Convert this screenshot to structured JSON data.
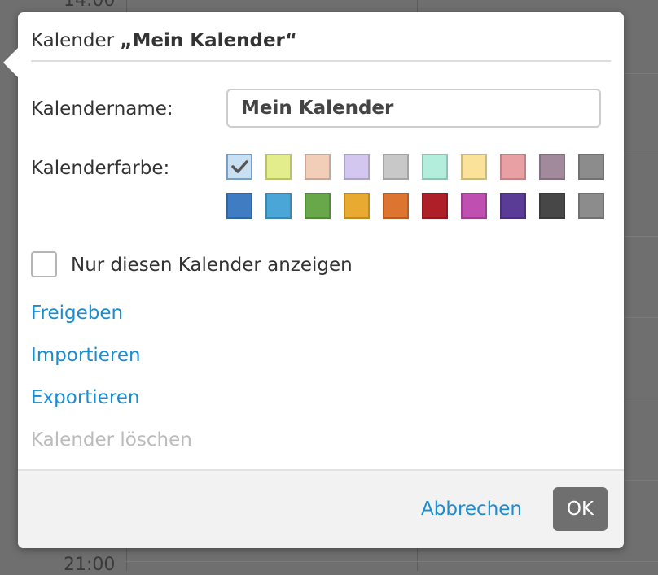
{
  "background": {
    "time_top": "14:00",
    "time_bottom": "21:00"
  },
  "dialog": {
    "title_prefix": "Kalender ",
    "title_name": "„Mein Kalender“",
    "name_label": "Kalendername:",
    "name_value": "Mein Kalender",
    "color_label": "Kalenderfarbe:",
    "colors": [
      "#c9dff2",
      "#e3ed8c",
      "#f2cdb8",
      "#d3c7f0",
      "#c8c8c8",
      "#b3eddb",
      "#fbe29a",
      "#e8a0a4",
      "#a08a9c",
      "#8c8c8c",
      "#3f7cc2",
      "#4aa6d6",
      "#68a84a",
      "#e8aa30",
      "#dd7430",
      "#ae1f27",
      "#bf4fb0",
      "#5a3b95",
      "#474747",
      "#8c8c8c"
    ],
    "selected_color_index": 0,
    "only_this_label": "Nur diesen Kalender anzeigen",
    "links": {
      "share": "Freigeben",
      "import": "Importieren",
      "export": "Exportieren",
      "delete": "Kalender löschen"
    },
    "cancel_label": "Abbrechen",
    "ok_label": "OK"
  },
  "colors": {
    "accent": "#1a8ccf",
    "ok_button": "#6f6f6f",
    "disabled_text": "#bbbbbb"
  },
  "icons": {
    "selected_swatch": "checkmark-icon"
  }
}
